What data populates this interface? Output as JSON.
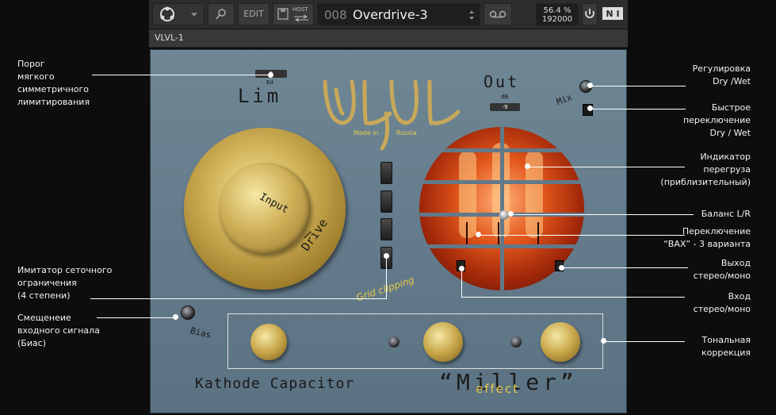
{
  "toolbar": {
    "edit_label": "EDIT",
    "host_label": "HOST",
    "preset_number": "008",
    "preset_name": "Overdrive-3",
    "cpu_percent": "56.4 %",
    "sample_rate": "192000"
  },
  "instance_name": "VLVL-1",
  "plugin": {
    "logo_text": "VLVL",
    "made_in": "Made in",
    "country": "Russia",
    "lim_label": "Lim",
    "lim_value": "0",
    "lim_unit": "Ed",
    "out_label": "Out",
    "out_unit": "dB",
    "out_value": "-9",
    "mix_label": "Mix",
    "input_label": "Input",
    "drive_label": "Drive",
    "grid_clipping_label": "Grid clipping",
    "bias_label": "Bias",
    "kathode_label": "Kathode Capacitor",
    "miller_label": "“Miller”",
    "effect_label": "effect"
  },
  "annotations": {
    "lim": "Порог\nмягкого\nсимметричного\nлимитирования",
    "grid": "Имитатор сеточного\nограничения\n(4 степени)",
    "bias": "Смещенеие\nвходного сигнала\n(Биас)",
    "drywet": "Регулировка\nDry /Wet",
    "fast_switch": "Быстрое\nпереключение\nDry / Wet",
    "overload": "Индикатор\nперегруза\n(приблизительный)",
    "balance": "Баланс L/R",
    "vax": "Переключение\n“ВАХ” - 3 варианта",
    "output": "Выход\nстерео/моно",
    "input": "Вход\nстерео/моно",
    "tone": "Тональная\nкоррекция"
  },
  "colors": {
    "panel": "#6a8291",
    "gold": "#c9a64a",
    "tube_orange": "#e2561a"
  }
}
